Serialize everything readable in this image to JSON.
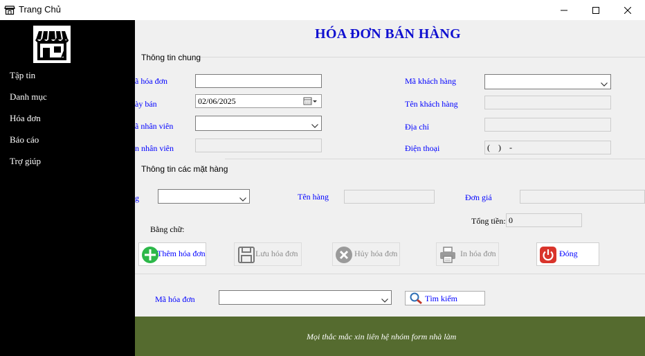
{
  "window": {
    "title": "Trang Chủ",
    "icons": {
      "app": "shop-icon",
      "minimize": "minimize-icon",
      "maximize": "maximize-icon",
      "close": "close-icon"
    }
  },
  "sidebar": {
    "logo_icon": "store-icon",
    "items": [
      {
        "label": "Tập tin"
      },
      {
        "label": "Danh mục"
      },
      {
        "label": "Hóa đơn"
      },
      {
        "label": "Báo cáo"
      },
      {
        "label": "Trợ giúp"
      }
    ]
  },
  "form": {
    "title": "HÓA ĐƠN BÁN HÀNG",
    "general": {
      "group_title": "Thông tin chung",
      "invoice_id_label": "ã hóa đơn",
      "invoice_id_value": "",
      "date_label": "ày bán",
      "date_value": "02/06/2025",
      "employee_id_label": "ã nhân viên",
      "employee_id_value": "",
      "employee_name_label": "n nhân viên",
      "employee_name_value": "",
      "customer_id_label": "Mã khách hàng",
      "customer_id_value": "",
      "customer_name_label": "Tên khách hàng",
      "customer_name_value": "",
      "address_label": "Địa chỉ",
      "address_value": "",
      "phone_label": "Điện thoại",
      "phone_value": "(    )    -"
    },
    "items": {
      "group_title": "Thông tin các mặt hàng",
      "item_id_label": "g",
      "item_id_value": "",
      "item_name_label": "Tên hàng",
      "item_name_value": "",
      "price_label": "Đơn giá",
      "price_value": "",
      "total_label": "Tổng tiền:",
      "total_value": "0",
      "in_words_label": "Bằng chữ:"
    },
    "buttons": {
      "add": "Thêm hóa đơn",
      "save": "Lưu hóa đơn",
      "cancel": "Hủy hóa đơn",
      "print": "In hóa đơn",
      "close": "Đóng"
    },
    "search": {
      "label": "Mã hóa đơn",
      "value": "",
      "button": "Tìm kiếm"
    },
    "footer_message": "Mọi thắc mắc xin liên hệ nhóm form nhà làm"
  },
  "colors": {
    "title_blue": "#1010d0",
    "label_blue": "#0000ff",
    "sidebar_bg": "#000000",
    "footer_bg": "#556b2f",
    "add_green": "#2db84a",
    "close_red": "#d9342b"
  }
}
